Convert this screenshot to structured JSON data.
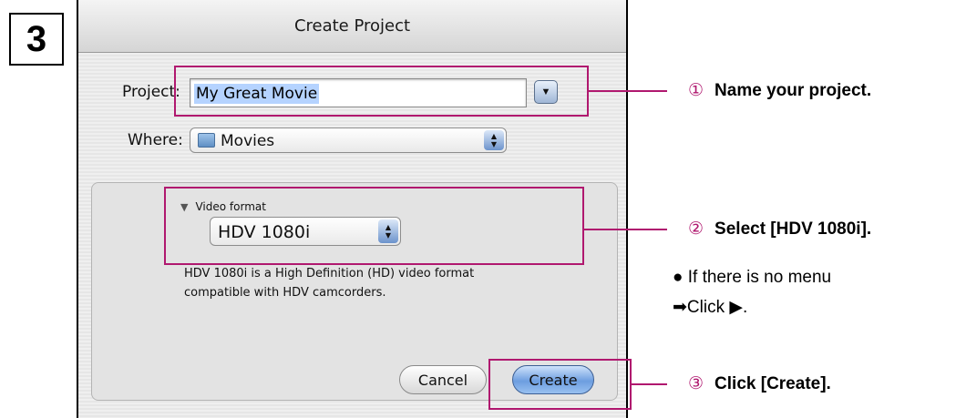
{
  "step": {
    "number": "3"
  },
  "dialog": {
    "title": "Create Project",
    "project_label": "Project:",
    "project_value": "My Great Movie",
    "where_label": "Where:",
    "where_value": "Movies",
    "video_format_label": "Video format",
    "video_format_value": "HDV 1080i",
    "format_description": "HDV 1080i is a High Definition (HD) video format compatible with HDV camcorders.",
    "cancel_label": "Cancel",
    "create_label": "Create"
  },
  "annotations": [
    {
      "number": "①",
      "text": "Name your project."
    },
    {
      "number": "②",
      "text": "Select [HDV 1080i]."
    },
    {
      "number": "③",
      "text": "Click [Create]."
    }
  ],
  "note": {
    "line1": "● If there is no menu",
    "line2": "➡Click ▶."
  },
  "colors": {
    "highlight": "#b0186f",
    "accent_button": "#6d9ee0"
  },
  "icons": [
    "disclosure-triangle-icon",
    "folder-icon",
    "popup-stepper-icon",
    "expand-arrow-icon"
  ]
}
